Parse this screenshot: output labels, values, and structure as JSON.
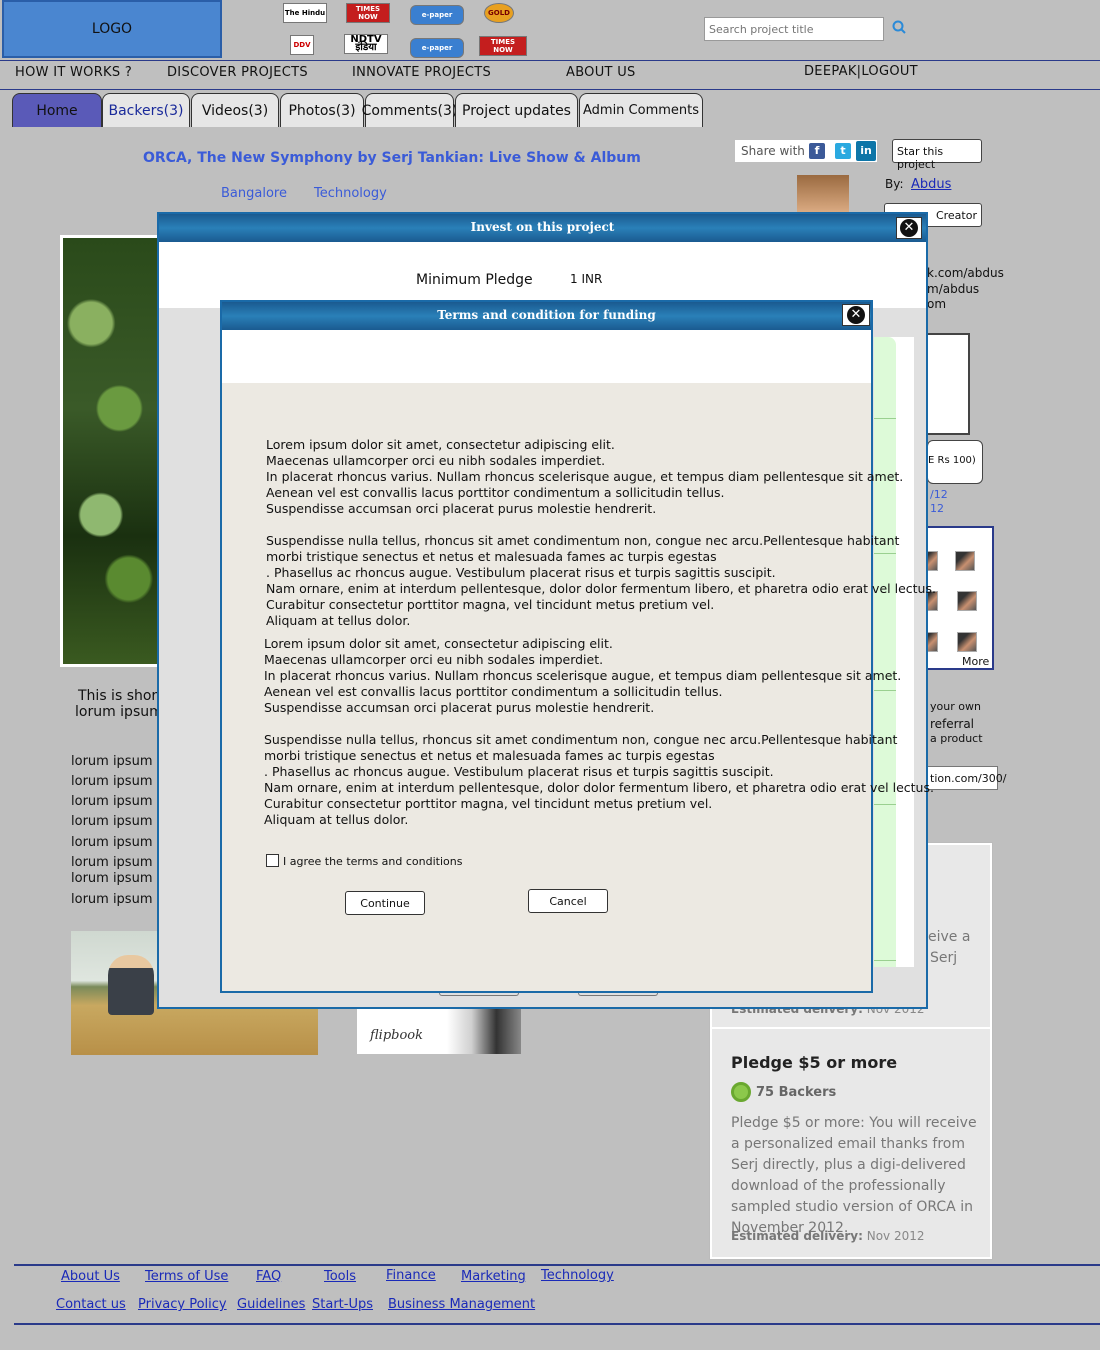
{
  "header": {
    "logo": "LOGO",
    "media_logos": [
      {
        "name": "the-hindu",
        "text": "The Hindu"
      },
      {
        "name": "times-now-1",
        "text": "TIMES NOW"
      },
      {
        "name": "epaper-1",
        "text": "e-paper"
      },
      {
        "name": "gold-seal",
        "text": "GOLD"
      },
      {
        "name": "ddv",
        "text": "DDV"
      },
      {
        "name": "ndtv-india",
        "text": "NDTV इंडिया"
      },
      {
        "name": "epaper-2",
        "text": "e-paper"
      },
      {
        "name": "times-now-2",
        "text": "TIMES NOW"
      }
    ],
    "search_placeholder": "Search project title"
  },
  "nav": {
    "how_it_works": "HOW IT WORKS ?",
    "discover": "DISCOVER PROJECTS",
    "innovate": "INNOVATE PROJECTS",
    "about": "ABOUT US",
    "user": "DEEPAK|LOGOUT"
  },
  "tabs": [
    {
      "id": "home",
      "label": "Home"
    },
    {
      "id": "backers",
      "label": "Backers(3)"
    },
    {
      "id": "videos",
      "label": "Videos(3)"
    },
    {
      "id": "photos",
      "label": "Photos(3)"
    },
    {
      "id": "comments",
      "label": "Comments(3)"
    },
    {
      "id": "updates",
      "label": "Project updates"
    },
    {
      "id": "admin",
      "label": "Admin Comments"
    }
  ],
  "project": {
    "title": "ORCA, The New Symphony by Serj Tankian: Live Show & Album",
    "location": "Bangalore",
    "category": "Technology",
    "share_label": "Share with",
    "star_button": "Star this project",
    "by_label": "By:",
    "creator_name": "Abdus",
    "creator_button": "Creator",
    "links": [
      "k.com/abdus",
      "m/abdus",
      "om"
    ],
    "pledge_button": "E Rs 100)",
    "dates": [
      "/12",
      "12"
    ],
    "more": "More",
    "referral_lines": [
      "your own",
      "referral",
      "a product"
    ],
    "referral_value": "tion.com/300/",
    "short_desc": [
      "This is shor",
      "lorum ipsum"
    ],
    "lorem_lines": [
      "lorum ipsum lo",
      "lorum ipsum lo",
      "lorum ipsum lo",
      "lorum ipsum lo",
      "lorum ipsum lo",
      "lorum ipsum lo",
      "lorum ipsum lo",
      "lorum ipsum lo"
    ],
    "flipbook": "flipbook"
  },
  "rewards": {
    "r1_desc": [
      "eive a",
      "Serj"
    ],
    "r1_est_label": "Estimated delivery:",
    "r1_est_value": "Nov 2012",
    "r2_title": "Pledge $5 or more",
    "r2_backers": "75 Backers",
    "r2_desc": "Pledge $5 or more: You will receive a personalized email thanks from Serj directly, plus a digi-delivered download of the professionally sampled studio version of ORCA in November 2012.",
    "r2_est_label": "Estimated delivery:",
    "r2_est_value": "Nov 2012"
  },
  "footer": {
    "row1": [
      "About Us",
      "Terms of Use",
      "FAQ",
      "Tools",
      "Finance",
      "Marketing",
      "Technology"
    ],
    "row2": [
      "Contact us",
      "Privacy Policy",
      "Guidelines",
      "Start-Ups",
      "Business Management"
    ]
  },
  "invest_modal": {
    "title": "Invest on this project",
    "min_label": "Minimum Pledge",
    "min_value": "1 INR"
  },
  "terms_modal": {
    "title": "Terms and condition for funding",
    "para1": "Lorem ipsum dolor sit amet, consectetur adipiscing elit.\nMaecenas ullamcorper orci eu nibh sodales imperdiet.\nIn placerat rhoncus varius. Nullam rhoncus scelerisque augue, et tempus diam pellentesque sit amet.\nAenean vel est convallis lacus porttitor condimentum a sollicitudin tellus.\nSuspendisse accumsan orci placerat purus molestie hendrerit.",
    "para2": "Suspendisse nulla tellus, rhoncus sit amet condimentum non, congue nec arcu.Pellentesque habitant\nmorbi tristique senectus et netus et malesuada fames ac turpis egestas\n. Phasellus ac rhoncus augue. Vestibulum placerat risus et turpis sagittis suscipit.\nNam ornare, enim at interdum pellentesque, dolor dolor fermentum libero, et pharetra odio erat vel lectus.\nCurabitur consectetur porttitor magna, vel tincidunt metus pretium vel.\nAliquam at tellus dolor.",
    "para3": "Lorem ipsum dolor sit amet, consectetur adipiscing elit.\nMaecenas ullamcorper orci eu nibh sodales imperdiet.\nIn placerat rhoncus varius. Nullam rhoncus scelerisque augue, et tempus diam pellentesque sit amet.\nAenean vel est convallis lacus porttitor condimentum a sollicitudin tellus.\nSuspendisse accumsan orci placerat purus molestie hendrerit.",
    "para4": "Suspendisse nulla tellus, rhoncus sit amet condimentum non, congue nec arcu.Pellentesque habitant\nmorbi tristique senectus et netus et malesuada fames ac turpis egestas\n. Phasellus ac rhoncus augue. Vestibulum placerat risus et turpis sagittis suscipit.\nNam ornare, enim at interdum pellentesque, dolor dolor fermentum libero, et pharetra odio erat vel lectus.\nCurabitur consectetur porttitor magna, vel tincidunt metus pretium vel.\nAliquam at tellus dolor.",
    "agree": "I agree the terms and conditions",
    "continue": "Continue",
    "cancel": "Cancel"
  }
}
